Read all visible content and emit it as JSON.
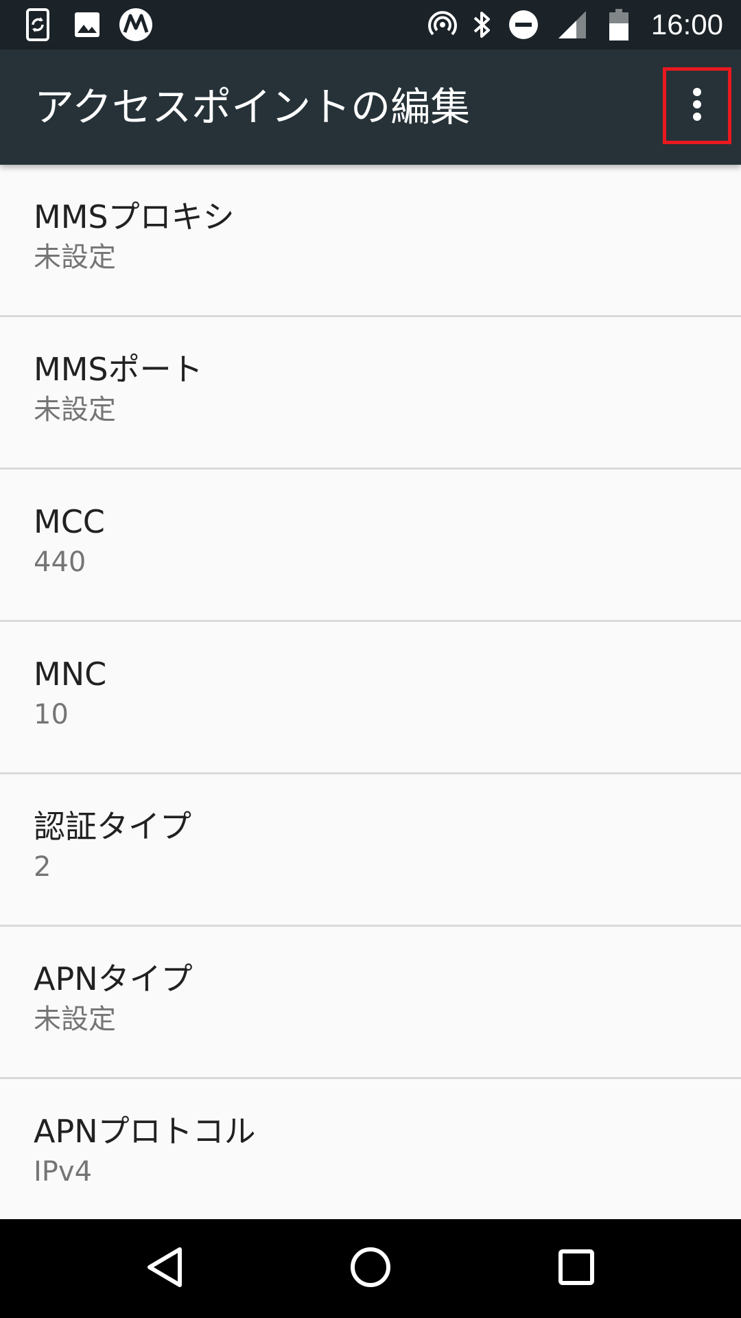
{
  "status_bar": {
    "time": "16:00",
    "left_icons": [
      "sync-phone-icon",
      "image-icon",
      "motorola-logo-icon"
    ],
    "right_icons": [
      "hotspot-icon",
      "bluetooth-icon",
      "do-not-disturb-icon",
      "cell-signal-icon",
      "battery-icon"
    ]
  },
  "app_bar": {
    "title": "アクセスポイントの編集",
    "overflow_icon": "more-vert-icon",
    "highlight_color": "#e8191f"
  },
  "settings": [
    {
      "title": "MMSプロキシ",
      "summary": "未設定"
    },
    {
      "title": "MMSポート",
      "summary": "未設定"
    },
    {
      "title": "MCC",
      "summary": "440"
    },
    {
      "title": "MNC",
      "summary": "10"
    },
    {
      "title": "認証タイプ",
      "summary": "2"
    },
    {
      "title": "APNタイプ",
      "summary": "未設定"
    },
    {
      "title": "APNプロトコル",
      "summary": "IPv4"
    }
  ],
  "nav_bar": {
    "icons": [
      "back-icon",
      "home-icon",
      "recents-icon"
    ]
  },
  "colors": {
    "status_bar": "#1b2328",
    "app_bar": "#263238",
    "background": "#fafafa",
    "primary_text": "#212121",
    "secondary_text": "#757575"
  }
}
